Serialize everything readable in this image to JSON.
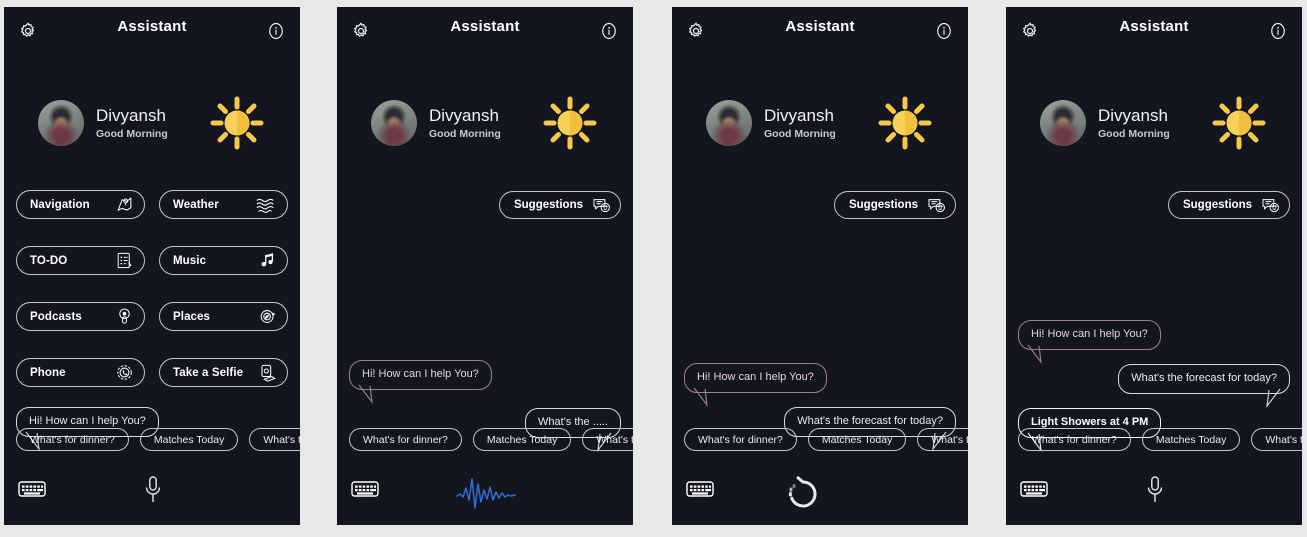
{
  "header": {
    "title": "Assistant",
    "settings_icon": "gear-icon",
    "info_icon": "info-icon"
  },
  "greeting": {
    "name": "Divyansh",
    "subtitle": "Good Morning",
    "avatar_icon": "user-avatar-photo",
    "weather_icon": "sun-icon"
  },
  "colors": {
    "panel_bg": "#13161f",
    "page_bg": "#e8e8e8",
    "outline": "#c4c6cf",
    "text": "#ffffff",
    "sun_yellow": "#f6c84c",
    "bubble_mauve": "#9e8089",
    "waveform_blue": "#2f6fd0"
  },
  "menu": {
    "items": [
      {
        "label": "Navigation",
        "icon": "map-pin-icon"
      },
      {
        "label": "Weather",
        "icon": "waves-icon"
      },
      {
        "label": "TO-DO",
        "icon": "checklist-icon"
      },
      {
        "label": "Music",
        "icon": "music-note-icon"
      },
      {
        "label": "Podcasts",
        "icon": "podcast-mic-icon"
      },
      {
        "label": "Places",
        "icon": "compass-icon"
      },
      {
        "label": "Phone",
        "icon": "phone-icon"
      },
      {
        "label": "Take a Selfie",
        "icon": "camera-phone-icon"
      }
    ]
  },
  "suggestions_button": {
    "label": "Suggestions",
    "icon": "chat-smiley-icon"
  },
  "chips": [
    {
      "label": "What's for dinner?"
    },
    {
      "label": "Matches Today"
    },
    {
      "label": "What's the news today?"
    }
  ],
  "bottom_bar": {
    "keyboard_icon": "keyboard-icon",
    "mic_icon": "microphone-icon",
    "waveform_icon": "audio-waveform-icon",
    "loading_icon": "loading-spinner-icon"
  },
  "panels": [
    {
      "id": "panel-home",
      "state": "home",
      "bubbles": [
        {
          "text": "Hi! How can I help You?",
          "side": "left",
          "style": "plain"
        }
      ],
      "bottom_center": "mic-icon"
    },
    {
      "id": "panel-listening",
      "state": "listening",
      "bubbles": [
        {
          "text": "Hi! How can I help You?",
          "side": "left",
          "style": "mauve"
        },
        {
          "text": "What's the .....",
          "side": "right",
          "style": "plain"
        }
      ],
      "bottom_center": "waveform-icon"
    },
    {
      "id": "panel-processing",
      "state": "processing",
      "bubbles": [
        {
          "text": "Hi! How can I help You?",
          "side": "left",
          "style": "mauve"
        },
        {
          "text": "What's the forecast for today?",
          "side": "right",
          "style": "plain"
        }
      ],
      "bottom_center": "loading-icon"
    },
    {
      "id": "panel-answered",
      "state": "answered",
      "bubbles": [
        {
          "text": "Hi! How can I help You?",
          "side": "left",
          "style": "mauve"
        },
        {
          "text": "What's the forecast for today?",
          "side": "right",
          "style": "plain"
        },
        {
          "text": "Light Showers at 4 PM",
          "side": "left",
          "style": "white"
        }
      ],
      "bottom_center": "mic-icon"
    }
  ]
}
